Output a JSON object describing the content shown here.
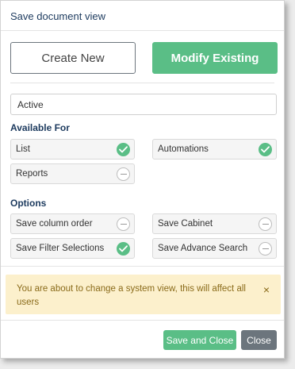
{
  "dialog": {
    "title": "Save document view",
    "mode": {
      "create_label": "Create New",
      "modify_label": "Modify Existing"
    },
    "name_input_value": "Active",
    "available_for": {
      "heading": "Available For",
      "items": [
        {
          "label": "List",
          "checked": true
        },
        {
          "label": "Automations",
          "checked": true
        },
        {
          "label": "Reports",
          "checked": false
        }
      ]
    },
    "options": {
      "heading": "Options",
      "items": [
        {
          "label": "Save column order",
          "checked": false
        },
        {
          "label": "Save Cabinet",
          "checked": false
        },
        {
          "label": "Save Filter Selections",
          "checked": true
        },
        {
          "label": "Save Advance Search",
          "checked": false
        }
      ]
    },
    "alert": {
      "message": "You are about to change a system view, this will affect all users",
      "close_glyph": "×"
    },
    "footer": {
      "save_label": "Save and Close",
      "close_label": "Close"
    },
    "colors": {
      "accent_green": "#5abe86",
      "secondary_grey": "#6c757d",
      "title_navy": "#1c3a5e",
      "alert_bg": "#fcf0cc",
      "alert_text": "#8a6b1a"
    }
  }
}
